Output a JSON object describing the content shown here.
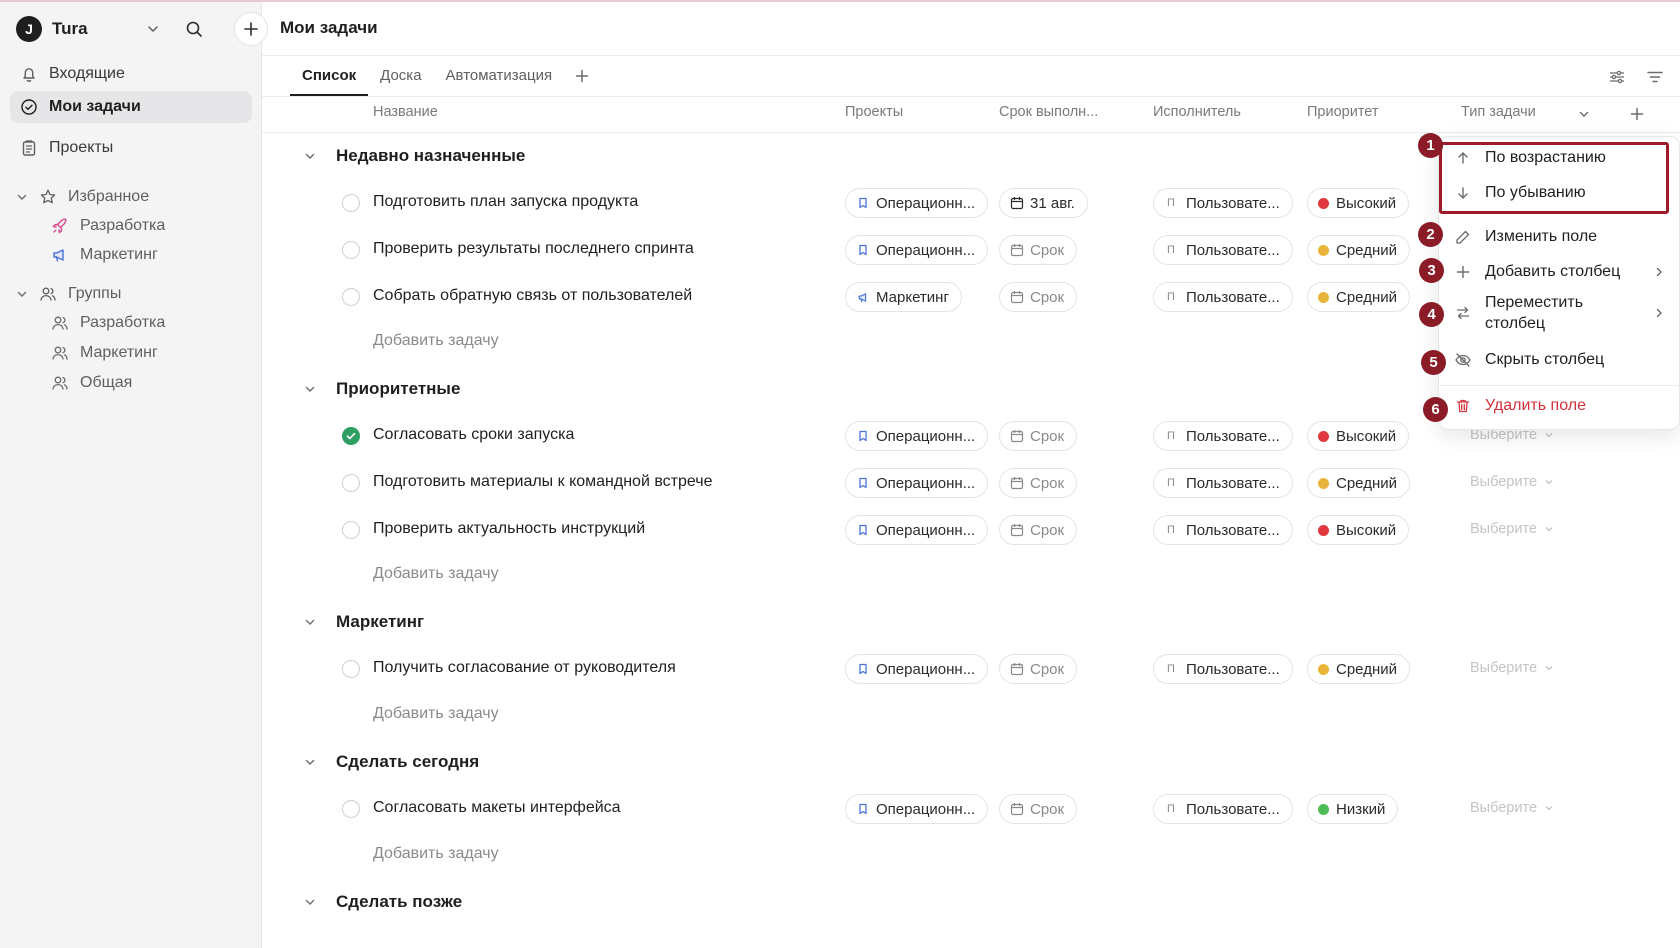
{
  "workspace": {
    "logo_letter": "J",
    "name": "Tura"
  },
  "sidebar": {
    "inbox": "Входящие",
    "my_tasks": "Мои задачи",
    "projects": "Проекты",
    "favorites": {
      "label": "Избранное",
      "items": [
        "Разработка",
        "Маркетинг"
      ]
    },
    "groups": {
      "label": "Группы",
      "items": [
        "Разработка",
        "Маркетинг",
        "Общая"
      ]
    }
  },
  "header": {
    "title": "Мои задачи"
  },
  "tabs": [
    "Список",
    "Доска",
    "Автоматизация"
  ],
  "columns": {
    "name": "Название",
    "projects": "Проекты",
    "due": "Срок выполн...",
    "assignee": "Исполнитель",
    "priority": "Приоритет",
    "type": "Тип задачи"
  },
  "groups": [
    {
      "title": "Недавно назначенные",
      "add": "Добавить задачу",
      "rows": [
        {
          "name": "Подготовить план запуска продукта",
          "project": "Операционн...",
          "due": "31 авг.",
          "assignee": "Пользовате...",
          "user_initial": "П",
          "priority": "Высокий",
          "type": ""
        },
        {
          "name": "Проверить результаты последнего спринта",
          "project": "Операционн...",
          "due": "Срок",
          "assignee": "Пользовате...",
          "user_initial": "П",
          "priority": "Средний",
          "type": ""
        },
        {
          "name": "Собрать обратную связь от пользователей",
          "project": "Маркетинг",
          "due": "Срок",
          "assignee": "Пользовате...",
          "user_initial": "П",
          "priority": "Средний",
          "type": ""
        }
      ]
    },
    {
      "title": "Приоритетные",
      "add": "Добавить задачу",
      "rows": [
        {
          "name": "Согласовать сроки запуска",
          "project": "Операционн...",
          "due": "Срок",
          "assignee": "Пользовате...",
          "user_initial": "П",
          "priority": "Высокий",
          "type": "Выберите"
        },
        {
          "name": "Подготовить материалы к командной встрече",
          "project": "Операционн...",
          "due": "Срок",
          "assignee": "Пользовате...",
          "user_initial": "П",
          "priority": "Средний",
          "type": "Выберите"
        },
        {
          "name": "Проверить актуальность инструкций",
          "project": "Операционн...",
          "due": "Срок",
          "assignee": "Пользовате...",
          "user_initial": "П",
          "priority": "Высокий",
          "type": "Выберите"
        }
      ]
    },
    {
      "title": "Маркетинг",
      "add": "Добавить задачу",
      "rows": [
        {
          "name": "Получить согласование от руководителя",
          "project": "Операционн...",
          "due": "Срок",
          "assignee": "Пользовате...",
          "user_initial": "П",
          "priority": "Средний",
          "type": "Выберите"
        }
      ]
    },
    {
      "title": "Сделать сегодня",
      "add": "Добавить задачу",
      "rows": [
        {
          "name": "Согласовать макеты интерфейса",
          "project": "Операционн...",
          "due": "Срок",
          "assignee": "Пользовате...",
          "user_initial": "П",
          "priority": "Низкий",
          "type": "Выберите"
        }
      ]
    },
    {
      "title": "Сделать позже"
    }
  ],
  "menu": {
    "sort_asc": "По возрастанию",
    "sort_desc": "По убыванию",
    "edit_field": "Изменить поле",
    "add_column": "Добавить столбец",
    "move_column": "Переместить столбец",
    "hide_column": "Скрыть столбец",
    "delete_field": "Удалить поле"
  },
  "badges": [
    "1",
    "2",
    "3",
    "4",
    "5",
    "6"
  ],
  "colors": {
    "high": "#e0383e",
    "medium": "#e8b43a",
    "low": "#4cbd57",
    "danger": "#d4313c",
    "annotation": "#8a1b27",
    "done": "#2e9e63"
  }
}
